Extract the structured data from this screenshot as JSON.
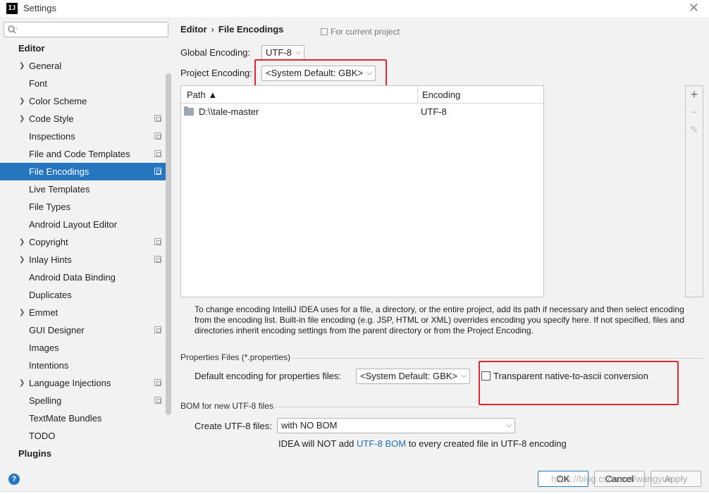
{
  "window": {
    "title": "Settings",
    "logo_text": "IJ",
    "close_glyph": "✕"
  },
  "search": {
    "value": "",
    "placeholder": ""
  },
  "sidebar": {
    "group_editor": "Editor",
    "items": [
      {
        "label": "General",
        "expandable": true,
        "project_icon": false
      },
      {
        "label": "Font",
        "expandable": false,
        "project_icon": false
      },
      {
        "label": "Color Scheme",
        "expandable": true,
        "project_icon": false
      },
      {
        "label": "Code Style",
        "expandable": true,
        "project_icon": true
      },
      {
        "label": "Inspections",
        "expandable": false,
        "project_icon": true
      },
      {
        "label": "File and Code Templates",
        "expandable": false,
        "project_icon": true
      },
      {
        "label": "File Encodings",
        "expandable": false,
        "project_icon": true,
        "selected": true
      },
      {
        "label": "Live Templates",
        "expandable": false,
        "project_icon": false
      },
      {
        "label": "File Types",
        "expandable": false,
        "project_icon": false
      },
      {
        "label": "Android Layout Editor",
        "expandable": false,
        "project_icon": false
      },
      {
        "label": "Copyright",
        "expandable": true,
        "project_icon": true
      },
      {
        "label": "Inlay Hints",
        "expandable": true,
        "project_icon": true
      },
      {
        "label": "Android Data Binding",
        "expandable": false,
        "project_icon": false
      },
      {
        "label": "Duplicates",
        "expandable": false,
        "project_icon": false
      },
      {
        "label": "Emmet",
        "expandable": true,
        "project_icon": false
      },
      {
        "label": "GUI Designer",
        "expandable": false,
        "project_icon": true
      },
      {
        "label": "Images",
        "expandable": false,
        "project_icon": false
      },
      {
        "label": "Intentions",
        "expandable": false,
        "project_icon": false
      },
      {
        "label": "Language Injections",
        "expandable": true,
        "project_icon": true
      },
      {
        "label": "Spelling",
        "expandable": false,
        "project_icon": true
      },
      {
        "label": "TextMate Bundles",
        "expandable": false,
        "project_icon": false
      },
      {
        "label": "TODO",
        "expandable": false,
        "project_icon": false
      }
    ],
    "group_plugins": "Plugins"
  },
  "breadcrumb": {
    "parent": "Editor",
    "separator": "›",
    "current": "File Encodings"
  },
  "for_current_project": "For current project",
  "global_encoding": {
    "label": "Global Encoding:",
    "value": "UTF-8"
  },
  "project_encoding": {
    "label": "Project Encoding:",
    "value": "<System Default: GBK>"
  },
  "table": {
    "columns": [
      "Path ▲",
      "Encoding"
    ],
    "rows": [
      {
        "path": "D:\\\\tale-master",
        "encoding": "UTF-8"
      }
    ],
    "tools": {
      "add": "+",
      "remove": "−",
      "edit": "✎"
    }
  },
  "description": "To change encoding IntelliJ IDEA uses for a file, a directory, or the entire project, add its path if necessary and then select encoding from the encoding list. Built-in file encoding (e.g. JSP, HTML or XML) overrides encoding you specify here. If not specified, files and directories inherit encoding settings from the parent directory or from the Project Encoding.",
  "properties": {
    "section_title": "Properties Files (*.properties)",
    "default_label": "Default encoding for properties files:",
    "default_value": "<System Default: GBK>",
    "transparent_label": "Transparent native-to-ascii conversion",
    "transparent_checked": false
  },
  "bom": {
    "section_title": "BOM for new UTF-8 files",
    "create_label": "Create UTF-8 files:",
    "create_value": "with NO BOM",
    "hint_prefix": "IDEA will NOT add ",
    "hint_link": "UTF-8 BOM",
    "hint_suffix": " to every created file in UTF-8 encoding"
  },
  "footer": {
    "help": "?",
    "ok": "OK",
    "cancel": "Cancel",
    "apply": "Apply",
    "watermark": "https://blog.csdn.net/wangyue"
  },
  "colors": {
    "accent": "#2675bf",
    "highlight_box": "#e0252c",
    "link": "#2470b3"
  }
}
